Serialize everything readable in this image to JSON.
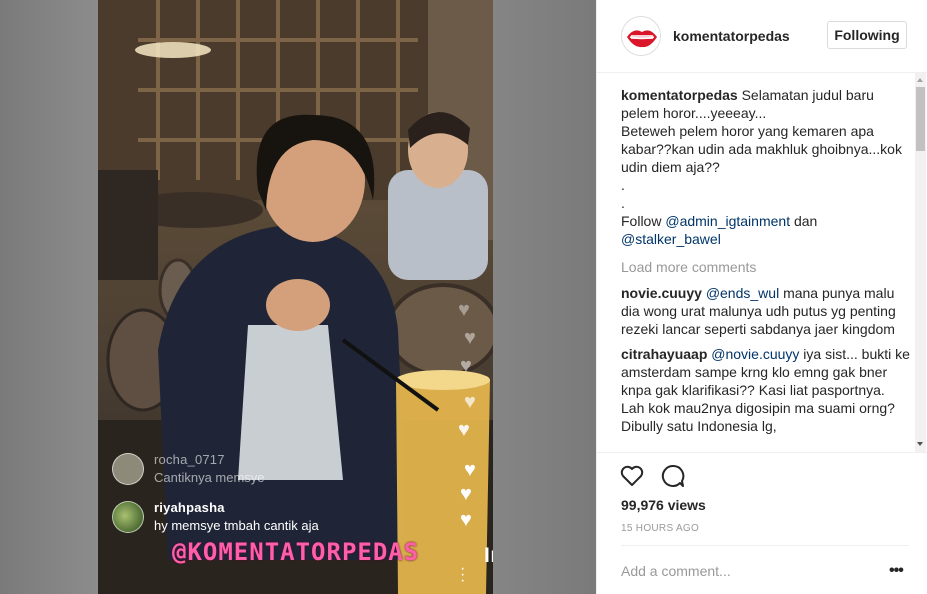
{
  "video": {
    "live_comments": [
      {
        "username": "rocha_0717",
        "message": "Cantiknya memsye",
        "faded": true
      },
      {
        "username": "riyahpasha",
        "message": "hy memsye tmbah cantik aja",
        "faded": false
      }
    ],
    "overlay_handle": "@KOMENTATORPEDAS",
    "app_watermark": "InShOt",
    "more_icon": "vertical-dots-icon",
    "heart_icon": "heart-icon"
  },
  "header": {
    "username": "komentatorpedas",
    "follow_label": "Following",
    "avatar_icon": "lips-logo"
  },
  "caption": {
    "username": "komentatorpedas",
    "lines": [
      "Selamatan judul baru pelem horor....yeeeay...",
      "Beteweh pelem horor yang kemaren apa kabar??kan udin ada makhluk ghoibnya...kok udin diem aja??",
      ".",
      "."
    ],
    "follow_prefix": "Follow ",
    "mention_1": "@admin_igtainment",
    "follow_mid": " dan",
    "mention_2": "@stalker_bawel"
  },
  "load_more": "Load more comments",
  "comments": [
    {
      "username": "novie.cuuyy",
      "mention": "@ends_wul",
      "text": " mana punya malu dia wong urat malunya udh putus yg penting rezeki lancar seperti sabdanya jaer kingdom"
    },
    {
      "username": "citrahayuaap",
      "mention": "@novie.cuuyy",
      "text": " iya sist... bukti ke amsterdam sampe krng klo emng gak bner knpa gak klarifikasi?? Kasi liat pasportnya. Lah kok mau2nya digosipin ma suami orng? Dibully satu Indonesia lg,"
    }
  ],
  "actions": {
    "like_icon": "heart-outline-icon",
    "comment_icon": "comment-bubble-icon",
    "views": "99,976 views",
    "timestamp": "15 HOURS AGO"
  },
  "comment_box": {
    "placeholder": "Add a comment...",
    "more_label": "•••"
  },
  "colors": {
    "mention": "#003569",
    "muted": "#999999",
    "text": "#262626",
    "overlay_handle": "#ff5fa8"
  }
}
